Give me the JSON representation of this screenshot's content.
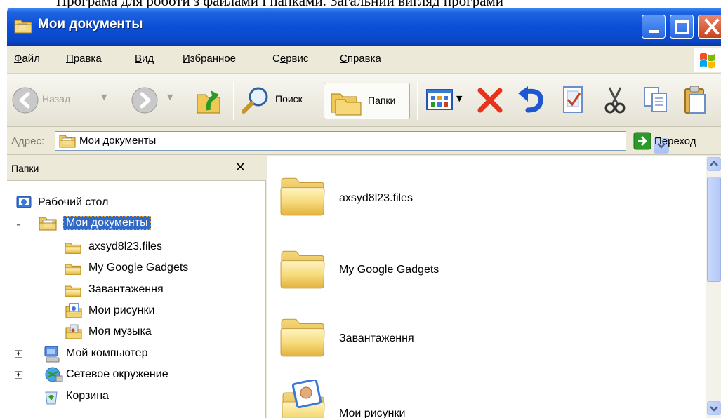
{
  "document_caption": "Програма для роботи з файлами і папками. Загальний вигляд програми",
  "window": {
    "title": "Мои документы",
    "icon": "folder-documents-icon"
  },
  "menu": {
    "items": [
      {
        "label_prefix": "",
        "label_underlined": "Ф",
        "label_rest": "айл"
      },
      {
        "label_prefix": "",
        "label_underlined": "П",
        "label_rest": "равка"
      },
      {
        "label_prefix": "",
        "label_underlined": "В",
        "label_rest": "ид"
      },
      {
        "label_prefix": "",
        "label_underlined": "И",
        "label_rest": "збранное"
      },
      {
        "label_prefix": "С",
        "label_underlined": "е",
        "label_rest": "рвис"
      },
      {
        "label_prefix": "",
        "label_underlined": "С",
        "label_rest": "правка"
      }
    ]
  },
  "toolbar": {
    "back_label": "Назад",
    "search_label": "Поиск",
    "folders_label": "Папки"
  },
  "address": {
    "label": "Адрес:",
    "value": "Мои документы",
    "go_label": "Переход"
  },
  "folders_pane": {
    "title": "Папки",
    "close_glyph": "×",
    "tree": [
      {
        "label": "Рабочий стол",
        "icon": "desktop-icon"
      },
      {
        "label": "Мои документы",
        "icon": "my-documents-icon",
        "selected": true
      },
      {
        "label": "axsyd8l23.files",
        "icon": "folder-icon"
      },
      {
        "label": "My Google Gadgets",
        "icon": "folder-icon"
      },
      {
        "label": "Завантаження",
        "icon": "folder-icon"
      },
      {
        "label": "Мои рисунки",
        "icon": "my-pictures-icon"
      },
      {
        "label": "Моя музыка",
        "icon": "my-music-icon"
      },
      {
        "label": "Мой компьютер",
        "icon": "my-computer-icon"
      },
      {
        "label": "Сетевое окружение",
        "icon": "network-icon"
      },
      {
        "label": "Корзина",
        "icon": "recycle-bin-icon"
      }
    ]
  },
  "content": {
    "items": [
      {
        "label": "axsyd8l23.files",
        "icon": "folder-icon"
      },
      {
        "label": "My Google Gadgets",
        "icon": "folder-icon"
      },
      {
        "label": "Завантаження",
        "icon": "folder-icon"
      },
      {
        "label": "Мои рисунки",
        "icon": "my-pictures-icon"
      }
    ]
  },
  "colors": {
    "titlebar": "#0b4fd8",
    "selection": "#316ac5",
    "window_bg": "#ece9d8"
  }
}
